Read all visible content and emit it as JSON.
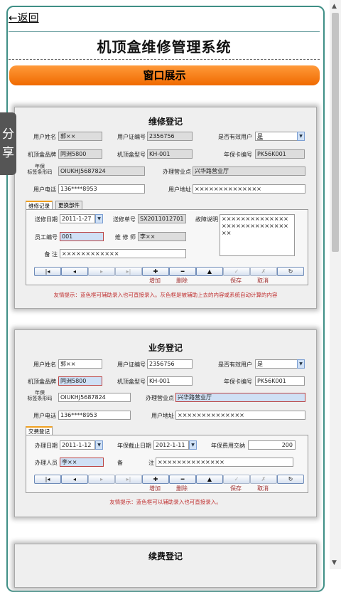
{
  "nav": {
    "back_label": "←返回"
  },
  "header": {
    "title": "机顶盒维修管理系统",
    "section_label": "窗口展示"
  },
  "side_share": {
    "line1": "分",
    "line2": "享"
  },
  "repair": {
    "title": "维修登记",
    "labels": {
      "name": "用户姓名",
      "cert": "用户证编号",
      "valid": "是否有效用户",
      "brand": "机顶盒品牌",
      "model": "机顶盒型号",
      "warranty_no": "年保卡编号",
      "barcode_top": "年保",
      "barcode_bottom": "标签条形码",
      "office": "办理营业点",
      "phone": "用户电话",
      "address": "用户地址"
    },
    "values": {
      "name": "郭××",
      "cert": "2356756",
      "valid": "是",
      "brand": "同洲5800",
      "model": "KH-001",
      "warranty_no": "PK56K001",
      "barcode": "OIUKHJ5687824",
      "office": "兴华路营业厅",
      "phone": "136****8953",
      "address": "××××××××××××××"
    },
    "tabs": [
      "维修记录",
      "更换部件"
    ],
    "sub_labels": {
      "date": "送修日期",
      "order": "送修单号",
      "fault": "故障说明",
      "staff": "员工编号",
      "repairer": "维 修 师",
      "remark": "备    注"
    },
    "sub_values": {
      "date": "2011-1-27",
      "order": "SX2011012701",
      "fault": "××××××××××××××××××××××××××××××",
      "staff": "001",
      "repairer": "李××",
      "remark": "××××××××××××"
    },
    "toolbar": {
      "first": "|◂",
      "prev": "◂",
      "next": "▸",
      "last": "▸|",
      "add": "✚",
      "delete": "━",
      "up": "▲",
      "save": "✓",
      "cancel": "✗",
      "refresh": "↻"
    },
    "toolbar_labels": {
      "add": "增加",
      "delete": "删除",
      "save": "保存",
      "cancel": "取消"
    },
    "tip": "友情提示：蓝色框可辅助录入也可直接录入。灰色框是被辅助上去的内容或系统自动计算的内容"
  },
  "business": {
    "title": "业务登记",
    "labels": {
      "name": "用户姓名",
      "cert": "用户证编号",
      "valid": "是否有效用户",
      "brand": "机顶盒品牌",
      "model": "机顶盒型号",
      "warranty_no": "年保卡编号",
      "barcode_top": "年保",
      "barcode_bottom": "标签条形码",
      "office": "办理营业点",
      "phone": "用户电话",
      "address": "用户地址"
    },
    "values": {
      "name": "郭××",
      "cert": "2356756",
      "valid": "是",
      "brand": "同洲5800",
      "model": "KH-001",
      "warranty_no": "PK56K001",
      "barcode": "OIUKHJ5687824",
      "office": "兴华路营业厅",
      "phone": "136****8953",
      "address": "××××××××××××××"
    },
    "tabs": [
      "交费登记"
    ],
    "sub_labels": {
      "date": "办理日期",
      "expire": "年保截止日期",
      "fee": "年保费用交纳",
      "handler": "办理人员",
      "remark": "备",
      "remark2": "注"
    },
    "sub_values": {
      "date": "2011-1-12",
      "expire": "2012-1-11",
      "fee": "200",
      "handler": "李××",
      "remark": "××××××××××××××"
    },
    "toolbar": {
      "first": "|◂",
      "prev": "◂",
      "next": "▸",
      "last": "▸|",
      "add": "✚",
      "delete": "━",
      "up": "▲",
      "save": "✓",
      "cancel": "✗",
      "refresh": "↻"
    },
    "toolbar_labels": {
      "add": "增加",
      "delete": "删除",
      "save": "保存",
      "cancel": "取消"
    },
    "tip": "友情提示：蓝色框可以辅助录入也可直接录入。"
  },
  "renewal": {
    "title": "续费登记"
  }
}
